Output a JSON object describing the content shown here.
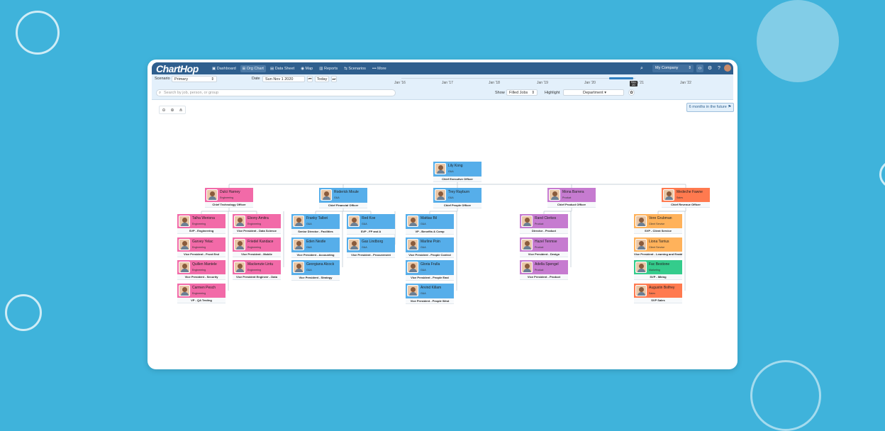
{
  "app": {
    "logo": "ChartHop"
  },
  "nav": [
    {
      "label": "Dashboard",
      "active": false
    },
    {
      "label": "Org Chart",
      "active": true
    },
    {
      "label": "Data Sheet",
      "active": false
    },
    {
      "label": "Map",
      "active": false
    },
    {
      "label": "Reports",
      "active": false
    },
    {
      "label": "Scenarios",
      "active": false
    },
    {
      "label": "More",
      "active": false
    }
  ],
  "topbar": {
    "company": "My Company"
  },
  "controls": {
    "scenario_label": "Scenario",
    "scenario_value": "Primary",
    "date_label": "Date",
    "date_value": "Sun Nov 1 2020",
    "today_label": "Today",
    "search_placeholder": "Search by job, person, or group",
    "show_label": "Show",
    "show_value": "Filled Jobs",
    "highlight_label": "Highlight",
    "highlight_value": "Department"
  },
  "timeline": {
    "years": [
      "Jan '16",
      "Jan '17",
      "Jan '18",
      "Jan '19",
      "Jan '20",
      "Jan '21",
      "Jan '22"
    ],
    "marker": "Nov 20"
  },
  "future_button": "6 months in the future",
  "colors": {
    "Engineering": "#f26aa8",
    "G&A": "#56aeea",
    "Product": "#c67bd0",
    "Sales": "#ff7a4f",
    "Client Service": "#ffb25b",
    "Marketing": "#34cc8c",
    "topbar": "#2f5f8e",
    "background": "#3fb3db"
  },
  "people": [
    {
      "name": "Lily Kong",
      "dept": "G&A",
      "title": "Chief Executive Officer"
    },
    {
      "name": "Dulci Harney",
      "dept": "Engineering",
      "title": "Chief Technology Officer"
    },
    {
      "name": "Roderick Moule",
      "dept": "G&A",
      "title": "Chief Financial Officer"
    },
    {
      "name": "Trey Rayburn",
      "dept": "G&A",
      "title": "Chief People Officer"
    },
    {
      "name": "Mona Barrera",
      "dept": "Product",
      "title": "Chief Product Officer"
    },
    {
      "name": "Medeche Fawne",
      "dept": "Sales",
      "title": "Chief Revenue Officer"
    },
    {
      "name": "Talha Weriona",
      "dept": "Engineering",
      "title": "SVP - Engineering"
    },
    {
      "name": "Garvey Yelac",
      "dept": "Engineering",
      "title": "Vice President - Front End"
    },
    {
      "name": "Quillen Mantele",
      "dept": "Engineering",
      "title": "Vice President - Security"
    },
    {
      "name": "Carmen Pesch",
      "dept": "Engineering",
      "title": "VP - QA Testing"
    },
    {
      "name": "Ebony Amitra",
      "dept": "Engineering",
      "title": "Vice President - Data Science"
    },
    {
      "name": "Friedel Kandace",
      "dept": "Engineering",
      "title": "Vice President - Mobile"
    },
    {
      "name": "Mackenzie Lintu",
      "dept": "Engineering",
      "title": "Vice President Engineer - Data"
    },
    {
      "name": "Franky Talbot",
      "dept": "G&A",
      "title": "Senior Director - Facilities"
    },
    {
      "name": "Eden Nestle",
      "dept": "G&A",
      "title": "Vice President - Accounting"
    },
    {
      "name": "Georgiana Alcock",
      "dept": "G&A",
      "title": "Vice President - Strategy"
    },
    {
      "name": "Red Koe",
      "dept": "G&A",
      "title": "SVP - FP and A"
    },
    {
      "name": "Gas Lindborg",
      "dept": "G&A",
      "title": "Vice President - Procurement"
    },
    {
      "name": "Mattias Bil",
      "dept": "G&A",
      "title": "VP - Benefits & Comp"
    },
    {
      "name": "Marline Poin",
      "dept": "G&A",
      "title": "Vice President - People Control"
    },
    {
      "name": "Gloria Frulla",
      "dept": "G&A",
      "title": "Vice President - People East"
    },
    {
      "name": "Arvind Killam",
      "dept": "G&A",
      "title": "Vice President - People West"
    },
    {
      "name": "Rand Clerkes",
      "dept": "Product",
      "title": "Director - Product"
    },
    {
      "name": "Hazel Tenmse",
      "dept": "Product",
      "title": "Vice President - Design"
    },
    {
      "name": "Adella Spengel",
      "dept": "Product",
      "title": "Vice President - Product"
    },
    {
      "name": "Vere Grubman",
      "dept": "Client Service",
      "title": "SVP - Client Service"
    },
    {
      "name": "Liona Tarrius",
      "dept": "Client Service",
      "title": "Vice President - Learning and Enablement"
    },
    {
      "name": "Fac Bestione",
      "dept": "Marketing",
      "title": "SVP - Mktng"
    },
    {
      "name": "Augustin Bolfrey",
      "dept": "Sales",
      "title": "SVP Sales"
    }
  ]
}
